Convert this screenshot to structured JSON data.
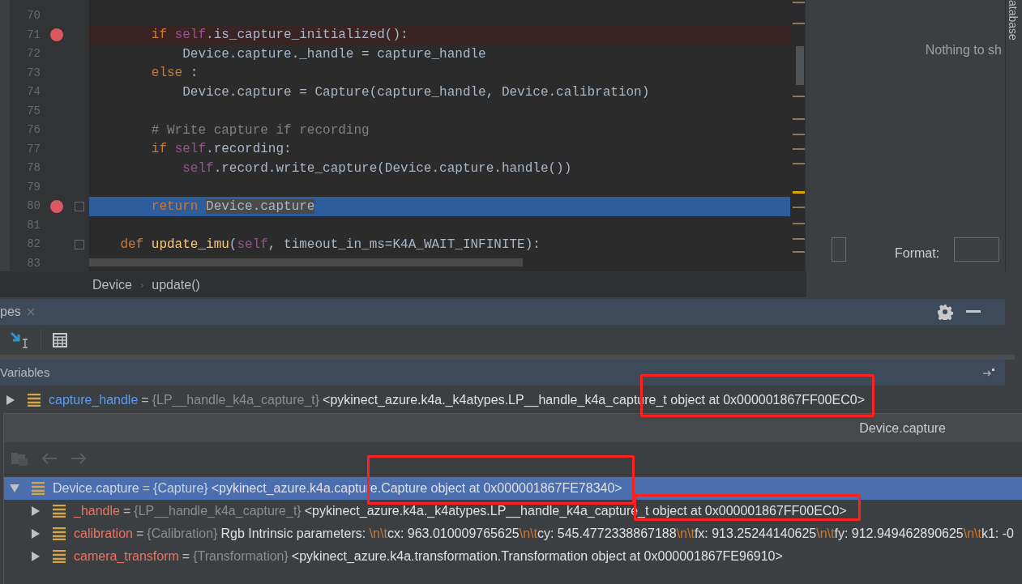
{
  "editor": {
    "lines": [
      {
        "number": "70",
        "breakpoint": false,
        "current": false,
        "fold": false
      },
      {
        "number": "71",
        "breakpoint": true,
        "current": false,
        "fold": false,
        "tokens": [
          {
            "text": "        if ",
            "kind": "keyword"
          },
          {
            "text": "self",
            "kind": "self"
          },
          {
            "text": ".is_capture_initialized():",
            "kind": "plain"
          }
        ]
      },
      {
        "number": "72",
        "breakpoint": false,
        "current": false,
        "fold": false,
        "tokens": [
          {
            "text": "            Device.capture._handle = capture_handle",
            "kind": "plain"
          }
        ]
      },
      {
        "number": "73",
        "breakpoint": false,
        "current": false,
        "fold": false,
        "tokens": [
          {
            "text": "        else",
            "kind": "keyword"
          },
          {
            "text": " :",
            "kind": "plain"
          }
        ]
      },
      {
        "number": "74",
        "breakpoint": false,
        "current": false,
        "fold": false,
        "tokens": [
          {
            "text": "            Device.capture = Capture(capture_handle, Device.calibration)",
            "kind": "plain"
          }
        ]
      },
      {
        "number": "75",
        "breakpoint": false,
        "current": false,
        "fold": false
      },
      {
        "number": "76",
        "breakpoint": false,
        "current": false,
        "fold": false,
        "tokens": [
          {
            "text": "        # Write capture if recording",
            "kind": "comment"
          }
        ]
      },
      {
        "number": "77",
        "breakpoint": false,
        "current": false,
        "fold": false,
        "tokens": [
          {
            "text": "        if ",
            "kind": "keyword"
          },
          {
            "text": "self",
            "kind": "self"
          },
          {
            "text": ".recording:",
            "kind": "plain"
          }
        ]
      },
      {
        "number": "78",
        "breakpoint": false,
        "current": false,
        "fold": false,
        "tokens": [
          {
            "text": "            self",
            "kind": "self"
          },
          {
            "text": ".record.write_capture(Device.capture.handle())",
            "kind": "plain"
          }
        ]
      },
      {
        "number": "79",
        "breakpoint": false,
        "current": false,
        "fold": false
      },
      {
        "number": "80",
        "breakpoint": true,
        "current": true,
        "fold": true,
        "tokens": [
          {
            "text": "        return ",
            "kind": "keyword"
          },
          {
            "text": "Device.capture",
            "kind": "selected"
          }
        ]
      },
      {
        "number": "81",
        "breakpoint": false,
        "current": false,
        "fold": false
      },
      {
        "number": "82",
        "breakpoint": false,
        "current": false,
        "fold": true,
        "tokens": [
          {
            "text": "    def ",
            "kind": "keyword"
          },
          {
            "text": "update_imu",
            "kind": "function"
          },
          {
            "text": "(",
            "kind": "plain"
          },
          {
            "text": "self",
            "kind": "self"
          },
          {
            "text": ", timeout_in_ms=K4A_WAIT_INFINITE):",
            "kind": "plain"
          }
        ]
      },
      {
        "number": "83",
        "breakpoint": false,
        "current": false,
        "fold": false
      }
    ]
  },
  "breadcrumb": {
    "separator": "›",
    "items": [
      "Device",
      "update()"
    ]
  },
  "side_panel": {
    "message": "Nothing to sh",
    "checked": false,
    "format_label": "Format:",
    "tab": "atabase"
  },
  "tool_window": {
    "tab": "pes",
    "section": "Variables",
    "variables": [
      {
        "name": "capture_handle",
        "operator": "=",
        "color": "#589df6",
        "type": "{LP__handle_k4a_capture_t}",
        "value": [
          {
            "text": "<pykinect_azure.k4a._k4atypes.LP__handle_k4a_capture_t object at 0x000001867FF00EC0>",
            "kind": "plain"
          }
        ],
        "expanded": false,
        "selected": false
      }
    ],
    "popup": {
      "title": "Device.capture",
      "items": [
        {
          "name": "Device.capture",
          "operator": "=",
          "color": "#d0d8e4",
          "type": "{Capture}",
          "value": [
            {
              "text": "<pykinect_azure.k4a.capture.Capture object at 0x000001867FE78340>",
              "kind": "plain"
            }
          ],
          "expanded": true,
          "selected": true,
          "children": [
            {
              "name": "_handle",
              "operator": "=",
              "color": "#f0735f",
              "type": "{LP__handle_k4a_capture_t}",
              "value": [
                {
                  "text": "<pykinect_azure.k4a._k4atypes.LP__handle_k4a_capture_t object at 0x000001867FF00EC0>",
                  "kind": "plain"
                }
              ],
              "expanded": false,
              "selected": false
            },
            {
              "name": "calibration",
              "operator": "=",
              "color": "#f0735f",
              "type": "{Calibration}",
              "value": [
                {
                  "text": "Rgb Intrinsic parameters: ",
                  "kind": "plain"
                },
                {
                  "text": "\\n\\t",
                  "kind": "escape"
                },
                {
                  "text": "cx: 963.010009765625",
                  "kind": "plain"
                },
                {
                  "text": "\\n\\t",
                  "kind": "escape"
                },
                {
                  "text": "cy: 545.4772338867188",
                  "kind": "plain"
                },
                {
                  "text": "\\n\\t",
                  "kind": "escape"
                },
                {
                  "text": "fx: 913.25244140625",
                  "kind": "plain"
                },
                {
                  "text": "\\n\\t",
                  "kind": "escape"
                },
                {
                  "text": "fy: 912.949462890625",
                  "kind": "plain"
                },
                {
                  "text": "\\n\\t",
                  "kind": "escape"
                },
                {
                  "text": "k1: -0",
                  "kind": "plain"
                }
              ],
              "expanded": false,
              "selected": false
            },
            {
              "name": "camera_transform",
              "operator": "=",
              "color": "#f0735f",
              "type": "{Transformation}",
              "value": [
                {
                  "text": "<pykinect_azure.k4a.transformation.Transformation object at 0x000001867FE96910>",
                  "kind": "plain"
                }
              ],
              "expanded": false,
              "selected": false
            }
          ]
        }
      ]
    }
  },
  "highlights": [
    {
      "color": "#ff2020"
    },
    {
      "color": "#ff2020"
    },
    {
      "color": "#ff2020"
    }
  ]
}
